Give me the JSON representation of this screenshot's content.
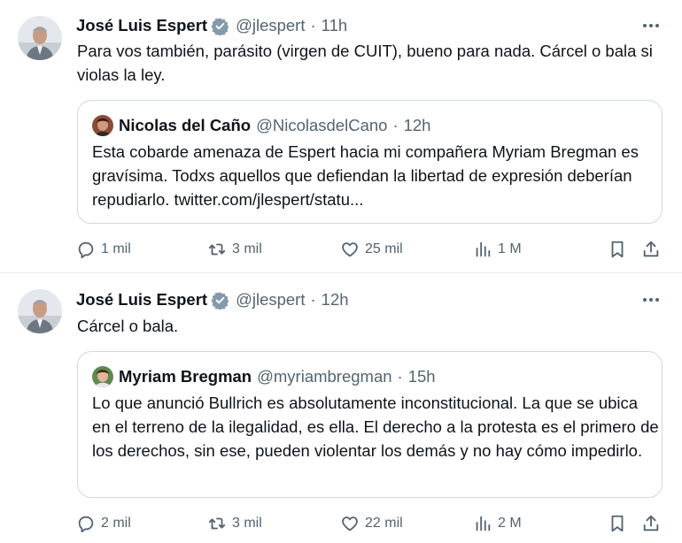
{
  "tweets": [
    {
      "author_name": "José Luis Espert",
      "author_handle": "@jlespert",
      "separator": "·",
      "time": "11h",
      "text": "Para vos también, parásito (virgen de CUIT), bueno para nada. Cárcel o bala si violas la ley.",
      "quote": {
        "author_name": "Nicolas del Caño",
        "author_handle": "@NicolasdelCano",
        "separator": "·",
        "time": "12h",
        "text": "Esta cobarde amenaza de Espert hacia mi compañera Myriam Bregman es gravísima. Todxs aquellos que defiendan la libertad de expresión deberían repudiarlo. twitter.com/jlespert/statu..."
      },
      "actions": {
        "replies": "1 mil",
        "retweets": "3 mil",
        "likes": "25 mil",
        "views": "1 M"
      }
    },
    {
      "author_name": "José Luis Espert",
      "author_handle": "@jlespert",
      "separator": "·",
      "time": "12h",
      "text": "Cárcel o bala.",
      "quote": {
        "author_name": "Myriam Bregman",
        "author_handle": "@myriambregman",
        "separator": "·",
        "time": "15h",
        "text": "Lo que anunció Bullrich es absolutamente inconstitucional. La que se ubica en el terreno de la ilegalidad, es ella. El derecho a la protesta es el primero de los derechos,  sin ese, pueden violentar los demás y no hay cómo impedirlo."
      },
      "actions": {
        "replies": "2 mil",
        "retweets": "3 mil",
        "likes": "22 mil",
        "views": "2 M"
      }
    }
  ],
  "icons": {
    "verified": "verified-badge-icon",
    "more": "more-options-icon",
    "reply": "reply-icon",
    "retweet": "retweet-icon",
    "like": "like-icon",
    "views": "views-icon",
    "bookmark": "bookmark-icon",
    "share": "share-icon"
  },
  "colors": {
    "verified": "#829aab",
    "secondary_text": "#536471",
    "border": "#cfd9de"
  }
}
